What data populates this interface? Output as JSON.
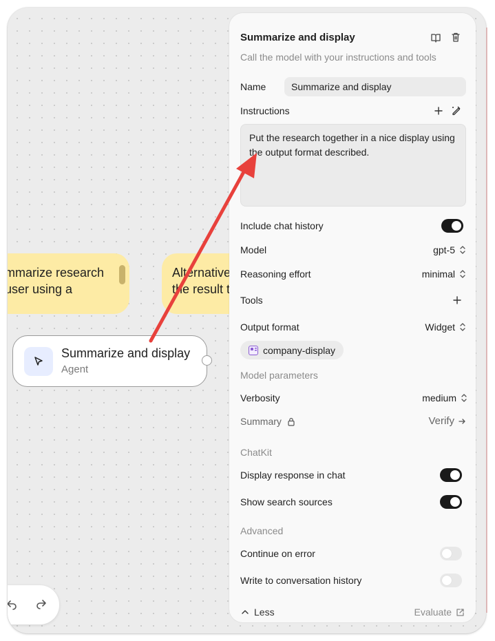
{
  "canvas": {
    "notes": [
      {
        "lines": [
          "mmarize research",
          "user using a"
        ]
      },
      {
        "lines": [
          "Alternative",
          "the result t"
        ]
      }
    ],
    "agent_node": {
      "title": "Summarize and display",
      "subtitle": "Agent",
      "icon": "cursor-arrow-icon"
    }
  },
  "panel": {
    "title": "Summarize and display",
    "subtitle": "Call the model with your instructions and tools",
    "header_icons": [
      "book-icon",
      "trash-icon"
    ],
    "name": {
      "label": "Name",
      "value": "Summarize and display"
    },
    "instructions": {
      "label": "Instructions",
      "value": "Put the research together in a nice display using the output format described.",
      "icons": [
        "plus-icon",
        "magic-pen-icon"
      ]
    },
    "include_chat_history": {
      "label": "Include chat history",
      "on": true
    },
    "model": {
      "label": "Model",
      "value": "gpt-5"
    },
    "reasoning_effort": {
      "label": "Reasoning effort",
      "value": "minimal"
    },
    "tools": {
      "label": "Tools"
    },
    "output_format": {
      "label": "Output format",
      "value": "Widget",
      "chip": "company-display"
    },
    "model_parameters": {
      "heading": "Model parameters",
      "verbosity": {
        "label": "Verbosity",
        "value": "medium"
      },
      "summary": {
        "label": "Summary",
        "action": "Verify"
      }
    },
    "chatkit": {
      "heading": "ChatKit",
      "display_response": {
        "label": "Display response in chat",
        "on": true
      },
      "show_sources": {
        "label": "Show search sources",
        "on": true
      }
    },
    "advanced": {
      "heading": "Advanced",
      "continue_on_error": {
        "label": "Continue on error",
        "on": false
      },
      "write_history": {
        "label": "Write to conversation history",
        "on": false
      }
    },
    "footer": {
      "less": "Less",
      "evaluate": "Evaluate"
    }
  },
  "colors": {
    "annotation_arrow": "#e8413c",
    "note": "#fdeba5",
    "agent_icon_bg": "#e7edff"
  }
}
